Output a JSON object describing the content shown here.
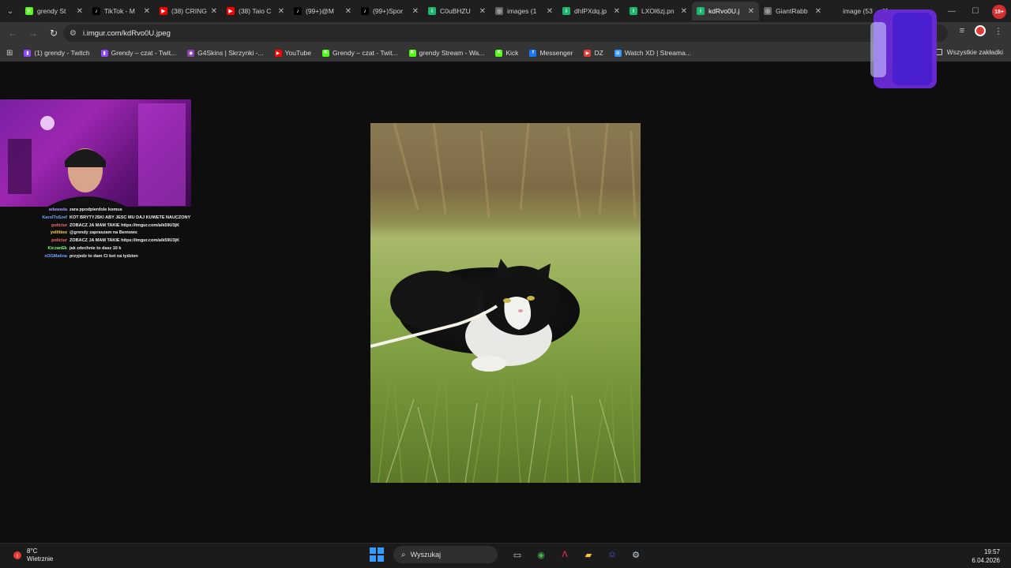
{
  "browser": {
    "tabs": [
      {
        "title": "grendy St",
        "fav_color": "#53fc18",
        "fav_glyph": "K",
        "active": false
      },
      {
        "title": "TikTok - M",
        "fav_color": "#000000",
        "fav_glyph": "♪",
        "active": false
      },
      {
        "title": "(38) CRING",
        "fav_color": "#ff0000",
        "fav_glyph": "▶",
        "active": false
      },
      {
        "title": "(38) Taio C",
        "fav_color": "#ff0000",
        "fav_glyph": "▶",
        "active": false
      },
      {
        "title": "(99+)@M",
        "fav_color": "#000000",
        "fav_glyph": "♪",
        "active": false
      },
      {
        "title": "(99+)Spor",
        "fav_color": "#000000",
        "fav_glyph": "♪",
        "active": false
      },
      {
        "title": "C0uBHZU",
        "fav_color": "#1bb76e",
        "fav_glyph": "i",
        "active": false
      },
      {
        "title": "images (1",
        "fav_color": "#666666",
        "fav_glyph": "◎",
        "active": false
      },
      {
        "title": "dhlPXdq.jp",
        "fav_color": "#1bb76e",
        "fav_glyph": "i",
        "active": false
      },
      {
        "title": "LXOl6zj.pn",
        "fav_color": "#1bb76e",
        "fav_glyph": "i",
        "active": false
      },
      {
        "title": "kdRvo0U.j",
        "fav_color": "#1bb76e",
        "fav_glyph": "i",
        "active": true
      },
      {
        "title": "GiantRabb",
        "fav_color": "#666666",
        "fav_glyph": "◎",
        "active": false
      },
      {
        "title": "image (53",
        "fav_color": "#1f1f1f",
        "fav_glyph": "",
        "active": false
      }
    ],
    "tab_close_glyph": "✕",
    "tab_search_glyph": "⌄",
    "window": {
      "minimize": "—",
      "maximize": "☐",
      "close": "✕"
    },
    "profile_badge": "18+",
    "nav": {
      "back": "←",
      "forward": "→",
      "reload": "↻"
    },
    "address": {
      "icon": "⚙",
      "url": "i.imgur.com/kdRvo0U.jpeg"
    },
    "toolbar_icons": {
      "media": "≡",
      "menu": "⋮"
    },
    "apps_glyph": "⊞",
    "bookmarks": [
      {
        "label": "(1) grendy - Twitch",
        "color": "#9146ff",
        "glyph": "▮"
      },
      {
        "label": "Grendy – czat - Twit...",
        "color": "#9146ff",
        "glyph": "▮"
      },
      {
        "label": "G4Skins | Skrzynki -...",
        "color": "#8e44ad",
        "glyph": "◆"
      },
      {
        "label": "YouTube",
        "color": "#ff0000",
        "glyph": "▶"
      },
      {
        "label": "Grendy – czat - Twit...",
        "color": "#53fc18",
        "glyph": "K"
      },
      {
        "label": "grendy Stream - Wa...",
        "color": "#53fc18",
        "glyph": "K"
      },
      {
        "label": "Kick",
        "color": "#53fc18",
        "glyph": "K"
      },
      {
        "label": "Messenger",
        "color": "#1877f2",
        "glyph": "f"
      },
      {
        "label": "DZ",
        "color": "#e53935",
        "glyph": "▶"
      },
      {
        "label": "Watch XD | Streama...",
        "color": "#3a9bff",
        "glyph": "⊙"
      }
    ],
    "all_bookmarks": "Wszystkie zakładki"
  },
  "stream_overlay": {
    "chat": [
      {
        "user": "adawada",
        "color": "#9c9cff",
        "msg": "zara ppodpierdole komus"
      },
      {
        "user": "KarolToSzef",
        "color": "#6fa8ff",
        "msg": "KOT BRYTYJSKI ABY JESC MU DAJ KUWETE NAUCZONY"
      },
      {
        "user": "policiur",
        "color": "#ff6b6b",
        "msg": "ZOBACZ JA MAM TAKIE https://imgur.com/a/k59U3jK"
      },
      {
        "user": "yellittoo",
        "color": "#ffd54f",
        "msg": "@grendy zapraszam na Bemowo"
      },
      {
        "user": "policiur",
        "color": "#ff6b6b",
        "msg": "ZOBACZ JA MAM TAKIE https://imgur.com/a/k59U3jK"
      },
      {
        "user": "KiczanEk",
        "color": "#7cfc7c",
        "msg": "jak zdechnie to dasz 10 k"
      },
      {
        "user": "xOGMalina",
        "color": "#6fa8ff",
        "msg": "przyjedz to dam Ci kot na tydzien"
      }
    ]
  },
  "taskbar": {
    "weather": {
      "temp": "8°C",
      "desc": "Wietrznie"
    },
    "search_label": "Wyszukaj",
    "apps": [
      {
        "name": "task-view-icon",
        "glyph": "▭",
        "color": "#cccccc"
      },
      {
        "name": "chrome-icon",
        "glyph": "◉",
        "color": "#4caf50"
      },
      {
        "name": "adobe-icon",
        "glyph": "Λ",
        "color": "#ff2d55"
      },
      {
        "name": "folder-icon",
        "glyph": "▰",
        "color": "#f5c542"
      },
      {
        "name": "discord-icon",
        "glyph": "☺",
        "color": "#5865f2"
      },
      {
        "name": "steam-icon",
        "glyph": "⚙",
        "color": "#c7d5e0"
      }
    ],
    "time": "19:57",
    "date": "6.04.2026"
  },
  "colors": {
    "accent": "#3a9bff",
    "active_tab": "#353535"
  }
}
